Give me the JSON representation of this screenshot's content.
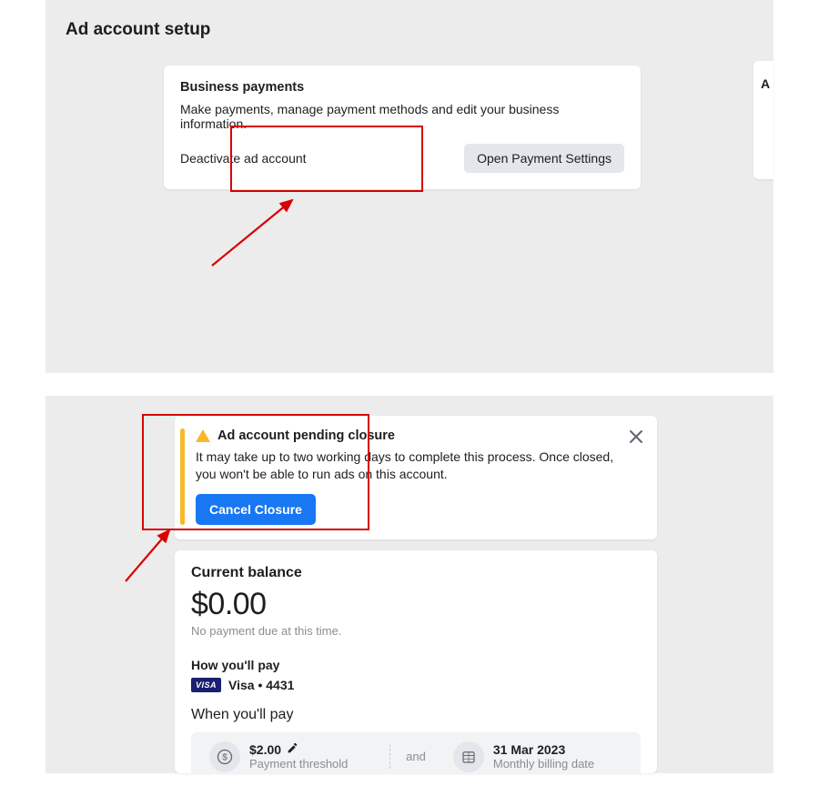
{
  "top": {
    "page_title": "Ad account setup",
    "card": {
      "heading": "Business payments",
      "description": "Make payments, manage payment methods and edit your business information.",
      "open_settings_label": "Open Payment Settings",
      "deactivate_label": "Deactivate ad account"
    },
    "side_stub_letter": "A"
  },
  "bottom": {
    "alert": {
      "title": "Ad account pending closure",
      "message": "It may take up to two working days to complete this process. Once closed, you won't be able to run ads on this account.",
      "cancel_label": "Cancel Closure"
    },
    "balance": {
      "heading": "Current balance",
      "amount": "$0.00",
      "note": "No payment due at this time."
    },
    "how_pay": {
      "label": "How you'll pay",
      "badge": "VISA",
      "method": "Visa • 4431"
    },
    "when_pay": {
      "label": "When you'll pay",
      "threshold_value": "$2.00",
      "threshold_label": "Payment threshold",
      "and": "and",
      "billing_date_value": "31 Mar 2023",
      "billing_date_label": "Monthly billing date"
    }
  }
}
